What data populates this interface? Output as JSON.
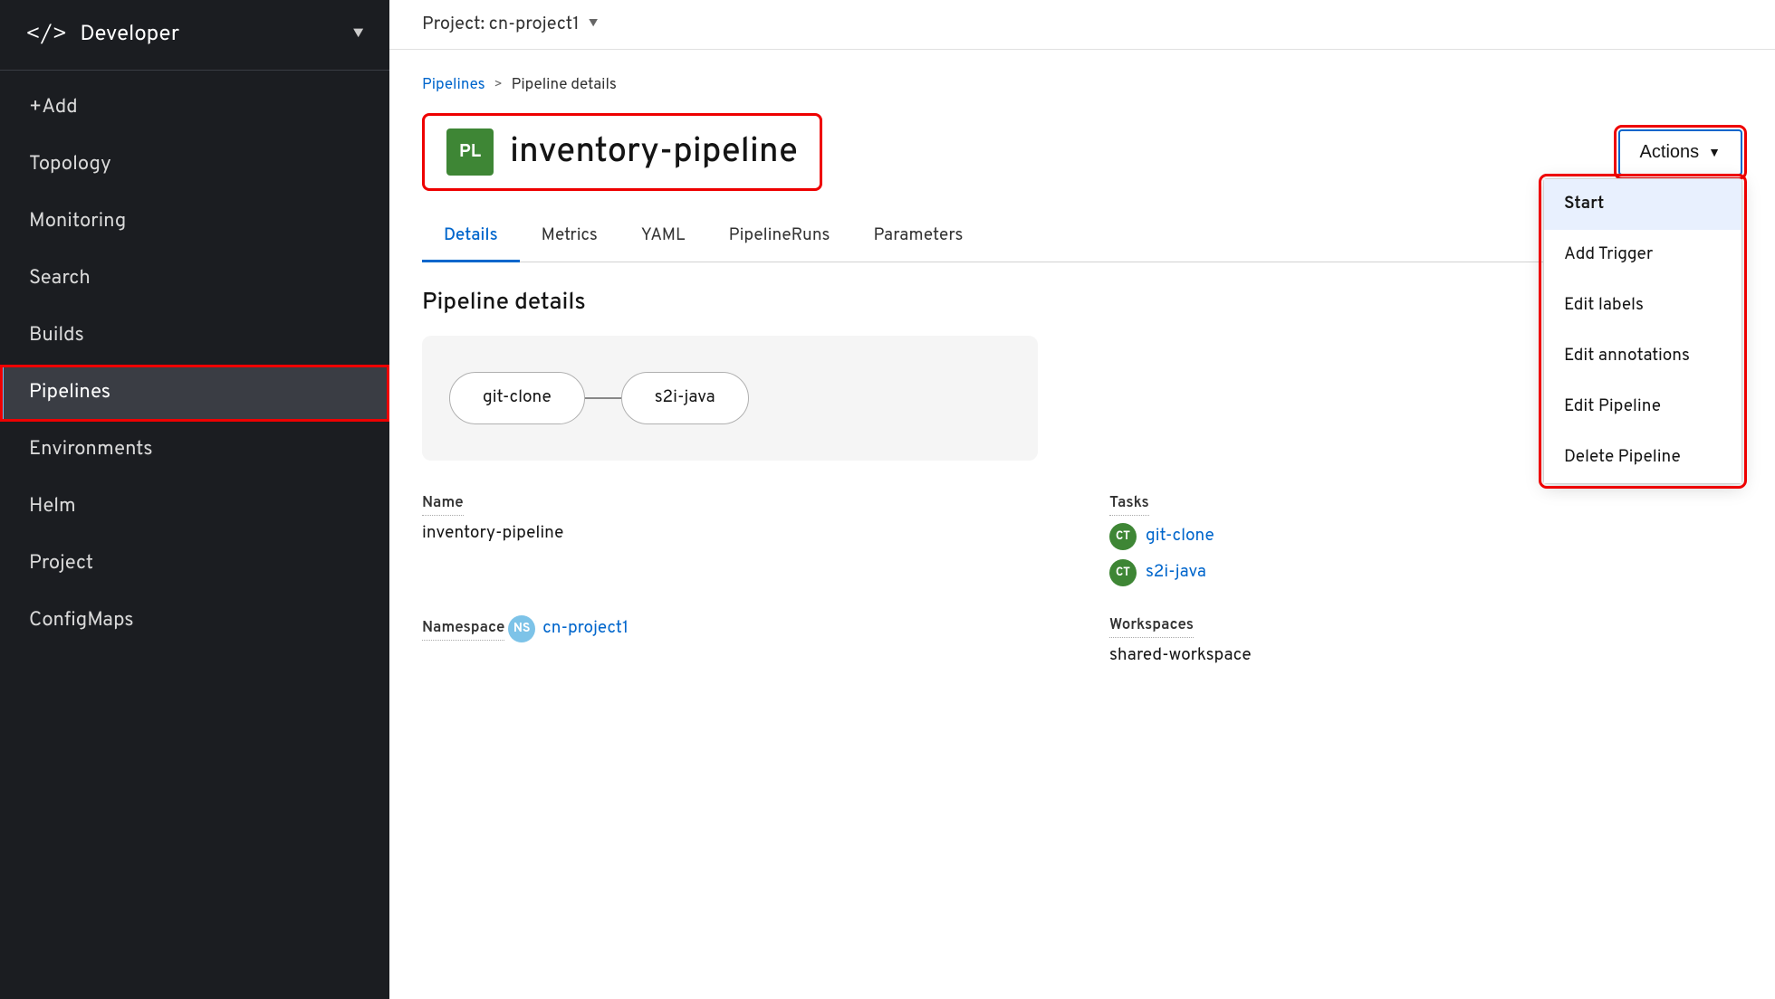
{
  "sidebar": {
    "header": {
      "icon": "</>",
      "title": "Developer",
      "chevron": "▼"
    },
    "items": [
      {
        "id": "add",
        "label": "+Add",
        "active": false
      },
      {
        "id": "topology",
        "label": "Topology",
        "active": false
      },
      {
        "id": "monitoring",
        "label": "Monitoring",
        "active": false
      },
      {
        "id": "search",
        "label": "Search",
        "active": false
      },
      {
        "id": "builds",
        "label": "Builds",
        "active": false
      },
      {
        "id": "pipelines",
        "label": "Pipelines",
        "active": true
      },
      {
        "id": "environments",
        "label": "Environments",
        "active": false
      },
      {
        "id": "helm",
        "label": "Helm",
        "active": false
      },
      {
        "id": "project",
        "label": "Project",
        "active": false
      },
      {
        "id": "configmaps",
        "label": "ConfigMaps",
        "active": false
      }
    ]
  },
  "topbar": {
    "project_label": "Project: cn-project1"
  },
  "breadcrumb": {
    "link": "Pipelines",
    "separator": ">",
    "current": "Pipeline details"
  },
  "page_title": {
    "icon_text": "PL",
    "title": "inventory-pipeline"
  },
  "actions_button": {
    "label": "Actions",
    "chevron": "▼"
  },
  "dropdown": {
    "items": [
      {
        "id": "start",
        "label": "Start",
        "highlighted": true
      },
      {
        "id": "add-trigger",
        "label": "Add Trigger"
      },
      {
        "id": "edit-labels",
        "label": "Edit labels"
      },
      {
        "id": "edit-annotations",
        "label": "Edit annotations"
      },
      {
        "id": "edit-pipeline",
        "label": "Edit Pipeline"
      },
      {
        "id": "delete-pipeline",
        "label": "Delete Pipeline"
      }
    ]
  },
  "tabs": [
    {
      "id": "details",
      "label": "Details",
      "active": true
    },
    {
      "id": "metrics",
      "label": "Metrics",
      "active": false
    },
    {
      "id": "yaml",
      "label": "YAML",
      "active": false
    },
    {
      "id": "pipelineruns",
      "label": "PipelineRuns",
      "active": false
    },
    {
      "id": "parameters",
      "label": "Parameters",
      "active": false
    }
  ],
  "section_title": "Pipeline details",
  "pipeline_diagram": {
    "nodes": [
      {
        "id": "git-clone",
        "label": "git-clone"
      },
      {
        "id": "s2i-java",
        "label": "s2i-java"
      }
    ]
  },
  "details": {
    "name_label": "Name",
    "name_value": "inventory-pipeline",
    "namespace_label": "Namespace",
    "namespace_icon": "NS",
    "namespace_value": "cn-project1",
    "tasks_label": "Tasks",
    "tasks": [
      {
        "icon": "CT",
        "label": "git-clone"
      },
      {
        "icon": "CT",
        "label": "s2i-java"
      }
    ],
    "workspaces_label": "Workspaces",
    "workspaces_value": "shared-workspace"
  }
}
